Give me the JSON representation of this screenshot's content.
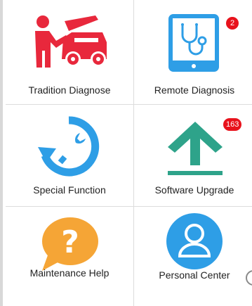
{
  "menu": {
    "items": [
      {
        "label": "Tradition Diagnose",
        "icon": "mechanic-car-icon",
        "badge": ""
      },
      {
        "label": "Remote Diagnosis",
        "icon": "tablet-stethoscope-icon",
        "badge": "2"
      },
      {
        "label": "Special Function",
        "icon": "wrench-reset-icon",
        "badge": ""
      },
      {
        "label": "Software Upgrade",
        "icon": "upload-arrow-icon",
        "badge": "163"
      },
      {
        "label": "Maintenance Help",
        "icon": "question-bubble-icon",
        "badge": ""
      },
      {
        "label": "Personal Center",
        "icon": "user-profile-icon",
        "badge": ""
      }
    ]
  },
  "colors": {
    "red": "#e8283c",
    "blue": "#2e9ee6",
    "green": "#2ea38a",
    "orange": "#f5a536",
    "badge": "#e8121c"
  }
}
